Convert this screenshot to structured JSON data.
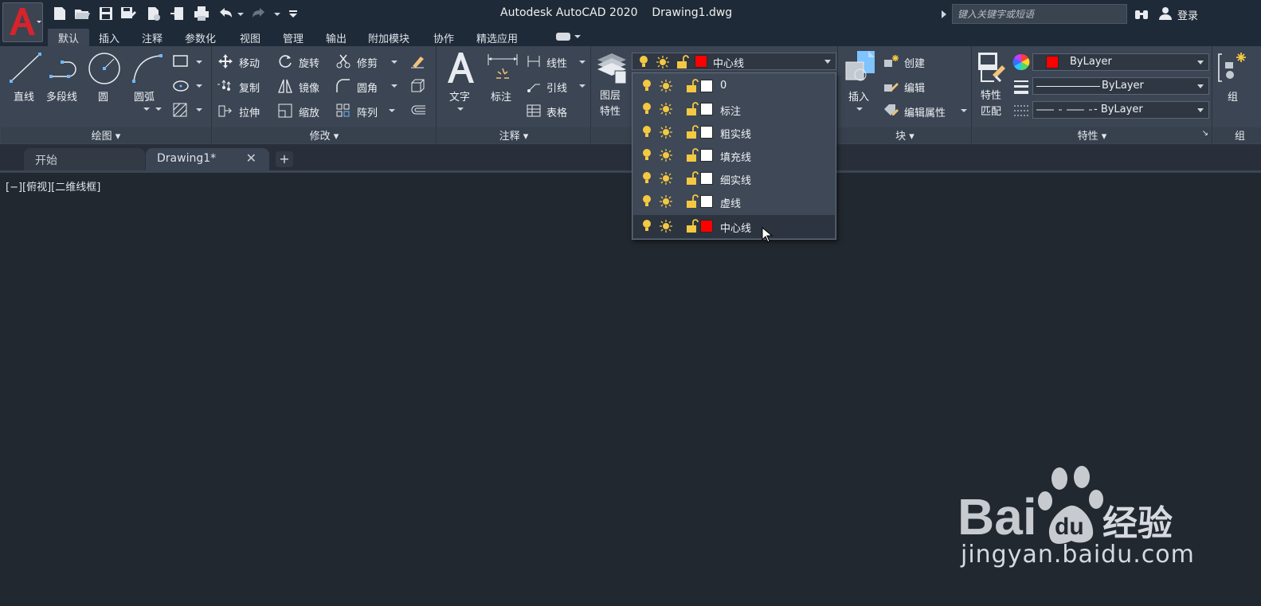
{
  "titlebar": {
    "app": "Autodesk AutoCAD 2020",
    "file": "Drawing1.dwg",
    "search_placeholder": "键入关键字或短语",
    "login": "登录"
  },
  "ribbon_tabs": [
    "默认",
    "插入",
    "注释",
    "参数化",
    "视图",
    "管理",
    "输出",
    "附加模块",
    "协作",
    "精选应用"
  ],
  "active_tab": "默认",
  "panels": {
    "draw": {
      "title": "绘图",
      "tools": {
        "line": "直线",
        "polyline": "多段线",
        "circle": "圆",
        "arc": "圆弧"
      }
    },
    "modify": {
      "title": "修改",
      "tools": {
        "move": "移动",
        "rotate": "旋转",
        "trim": "修剪",
        "copy": "复制",
        "mirror": "镜像",
        "fillet": "圆角",
        "stretch": "拉伸",
        "scale": "缩放",
        "array": "阵列"
      }
    },
    "annotation": {
      "title": "注释",
      "tools": {
        "text": "文字",
        "dimension": "标注",
        "linear": "线性",
        "leader": "引线",
        "table": "表格"
      }
    },
    "layers": {
      "properties_line1": "图层",
      "properties_line2": "特性",
      "current_layer": "中心线",
      "current_color": "#ff0000"
    },
    "block": {
      "title": "块",
      "tools": {
        "insert": "插入",
        "create": "创建",
        "edit": "编辑",
        "edit_attributes": "编辑属性"
      }
    },
    "properties": {
      "title": "特性",
      "match_line1": "特性",
      "match_line2": "匹配",
      "color": "ByLayer",
      "lineweight": "ByLayer",
      "linetype": "- ByLayer",
      "color_swatch": "#ff0000"
    },
    "groups": {
      "title": "组",
      "tool": "组"
    }
  },
  "layer_dropdown": {
    "items": [
      {
        "name": "0",
        "color": "#ffffff"
      },
      {
        "name": "标注",
        "color": "#ffffff"
      },
      {
        "name": "粗实线",
        "color": "#ffffff"
      },
      {
        "name": "填充线",
        "color": "#ffffff"
      },
      {
        "name": "细实线",
        "color": "#ffffff"
      },
      {
        "name": "虚线",
        "color": "#ffffff"
      },
      {
        "name": "中心线",
        "color": "#ff0000",
        "selected": true
      }
    ]
  },
  "doc_tabs": {
    "start": "开始",
    "drawing": "Drawing1*"
  },
  "viewport_label": "[−][俯视][二维线框]",
  "watermark": {
    "url": "jingyan.baidu.com",
    "brand_tail": "经验"
  }
}
